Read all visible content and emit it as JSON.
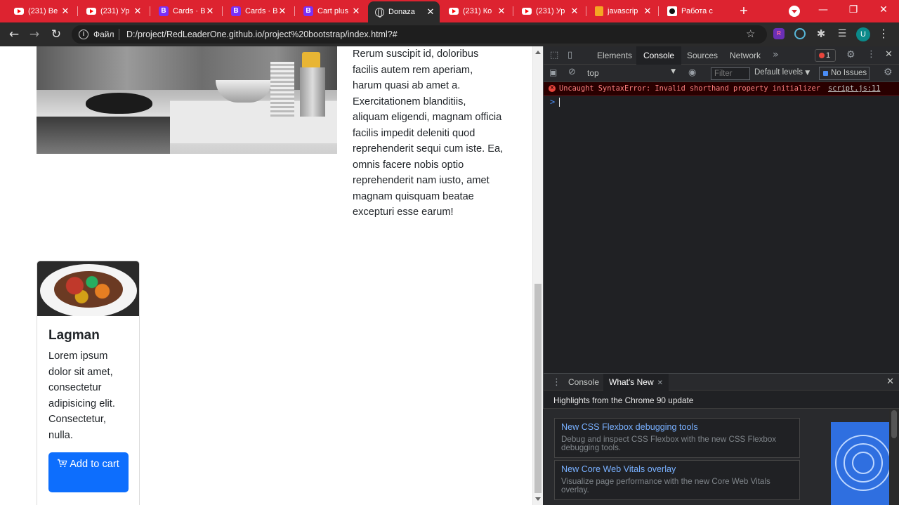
{
  "browser": {
    "tabs": [
      {
        "title": "(231) Be",
        "icon": "youtube-icon"
      },
      {
        "title": "(231) Ур",
        "icon": "youtube-icon"
      },
      {
        "title": "Cards · B",
        "icon": "bootstrap-icon"
      },
      {
        "title": "Cards · B",
        "icon": "bootstrap-icon"
      },
      {
        "title": "Cart plus",
        "icon": "bootstrap-icon"
      },
      {
        "title": "Donaza",
        "icon": "globe-icon"
      },
      {
        "title": "(231) Ко",
        "icon": "youtube-icon"
      },
      {
        "title": "(231) Ур",
        "icon": "youtube-icon"
      },
      {
        "title": "javascrip",
        "icon": "js-icon"
      },
      {
        "title": "Работа с",
        "icon": "github-icon"
      }
    ],
    "new_tab": "+",
    "window": {
      "minimize": "—",
      "restore": "❐",
      "close": "✕"
    },
    "nav": {
      "back": "←",
      "forward": "→",
      "reload": "↻"
    },
    "address": {
      "scheme_label": "Файл",
      "url": "D:/project/RedLeaderOne.github.io/project%20bootstrap/index.html?#"
    },
    "profile_initial": "U",
    "extension_r_label": "R"
  },
  "page": {
    "paragraph": "Rerum suscipit id, doloribus facilis autem rem aperiam, harum quasi ab amet a. Exercitationem blanditiis, aliquam eligendi, magnam officia facilis impedit deleniti quod reprehenderit sequi cum iste. Ea, omnis facere nobis optio reprehenderit nam iusto, amet magnam quisquam beatae excepturi esse earum!",
    "card": {
      "title": "Lagman",
      "text": "Lorem ipsum dolor sit amet, consectetur adipisicing elit. Consectetur, nulla.",
      "button_label": "Add to cart"
    },
    "colors": {
      "primary": "#0d6efd",
      "tab_strip": "#dd2330"
    }
  },
  "devtools": {
    "tabs": [
      "Elements",
      "Console",
      "Sources",
      "Network"
    ],
    "more_tabs": "»",
    "error_count": "1",
    "context": "top",
    "filter_placeholder": "Filter",
    "levels": "Default levels",
    "issues": "No Issues",
    "error_message": "Uncaught SyntaxError: Invalid shorthand property initializer",
    "error_source": "script.js:11",
    "prompt": ">",
    "drawer": {
      "tabs": [
        "Console",
        "What's New"
      ],
      "header": "Highlights from the Chrome 90 update",
      "items": [
        {
          "title": "New CSS Flexbox debugging tools",
          "desc": "Debug and inspect CSS Flexbox with the new CSS Flexbox debugging tools."
        },
        {
          "title": "New Core Web Vitals overlay",
          "desc": "Visualize page performance with the new Core Web Vitals overlay."
        }
      ]
    }
  }
}
